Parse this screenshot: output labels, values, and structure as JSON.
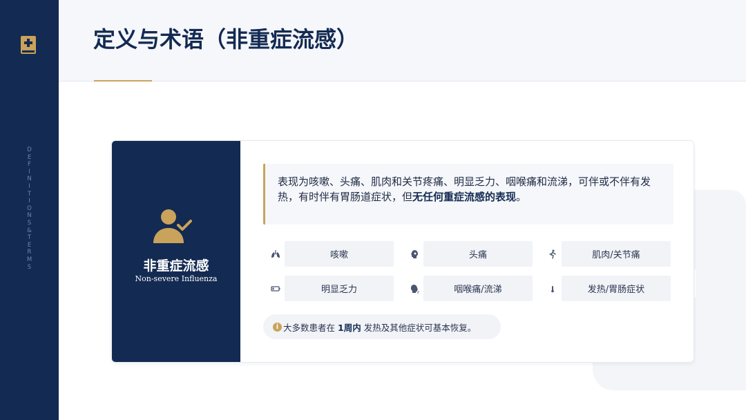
{
  "sidebar": {
    "vertical_text": [
      "D",
      "E",
      "F",
      "I",
      "N",
      "I",
      "T",
      "I",
      "O",
      "N",
      "S",
      "&",
      "T",
      "E",
      "R",
      "M",
      "S"
    ],
    "logo_icon": "medical-book-icon"
  },
  "header": {
    "title": "定义与术语（非重症流感）"
  },
  "card": {
    "left": {
      "icon": "user-check-icon",
      "title_zh": "非重症流感",
      "title_en": "Non-severe Influenza"
    },
    "quote": {
      "text_before": "表现为咳嗽、头痛、肌肉和关节疼痛、明显乏力、咽喉痛和流涕，可伴或不伴有发热，有时伴有胃肠道症状，但",
      "text_bold": "无任何重症流感的表现",
      "text_after": "。"
    },
    "symptoms": [
      {
        "label": "咳嗽",
        "icon": "lungs-icon"
      },
      {
        "label": "头痛",
        "icon": "head-icon"
      },
      {
        "label": "肌肉/关节痛",
        "icon": "running-person-icon"
      },
      {
        "label": "明显乏力",
        "icon": "battery-low-icon"
      },
      {
        "label": "咽喉痛/流涕",
        "icon": "head-side-cough-icon"
      },
      {
        "label": "发热/胃肠症状",
        "icon": "thermometer-icon"
      }
    ],
    "note": {
      "icon": "info-icon",
      "icon_glyph": "i",
      "before": "大多数患者在",
      "bold": "1周内",
      "after": "发热及其他症状可基本恢复。"
    }
  },
  "colors": {
    "navy": "#132a52",
    "gold": "#c9a35b",
    "panel": "#f5f7fa"
  }
}
